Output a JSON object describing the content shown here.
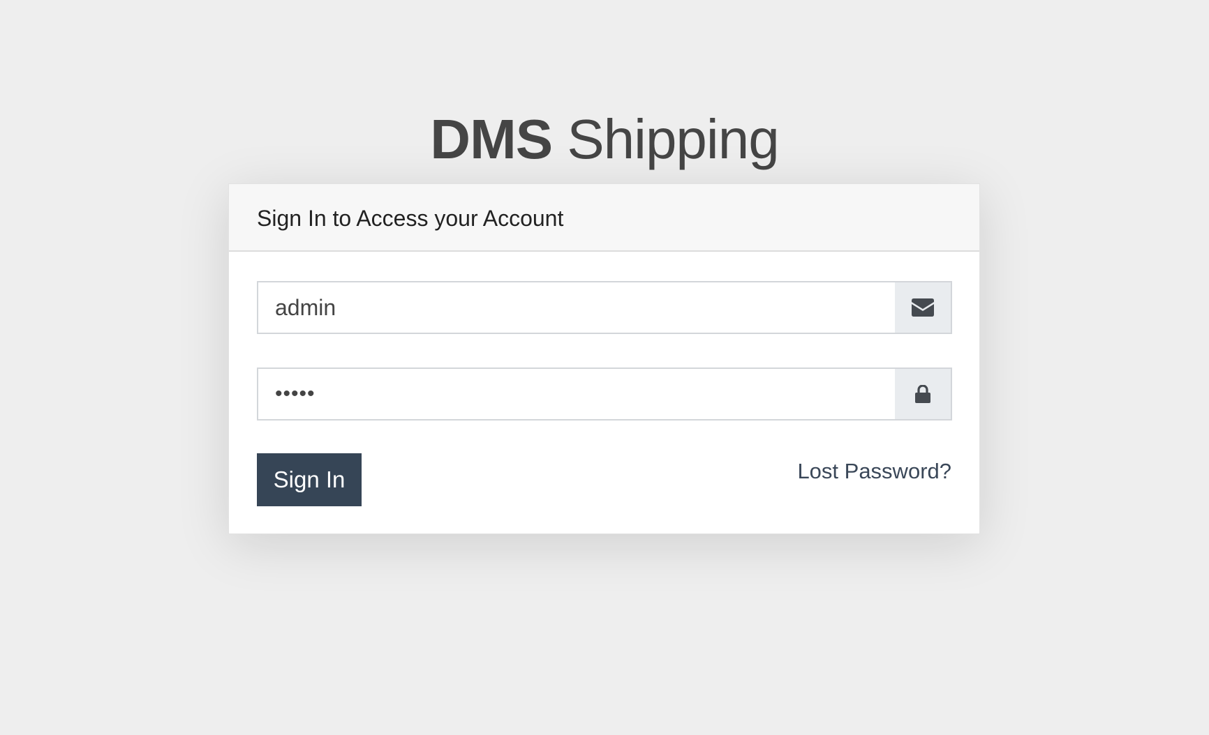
{
  "brand": {
    "bold": "DMS",
    "light": "Shipping"
  },
  "login_card": {
    "title": "Sign In to Access your Account",
    "username": {
      "value": "admin",
      "icon": "envelope-icon"
    },
    "password": {
      "value": "admin",
      "icon": "lock-icon"
    },
    "submit_label": "Sign In",
    "lost_password_label": "Lost Password?"
  },
  "colors": {
    "background": "#eeeeee",
    "button": "#364556",
    "link": "#3a4758",
    "title": "#454545"
  }
}
